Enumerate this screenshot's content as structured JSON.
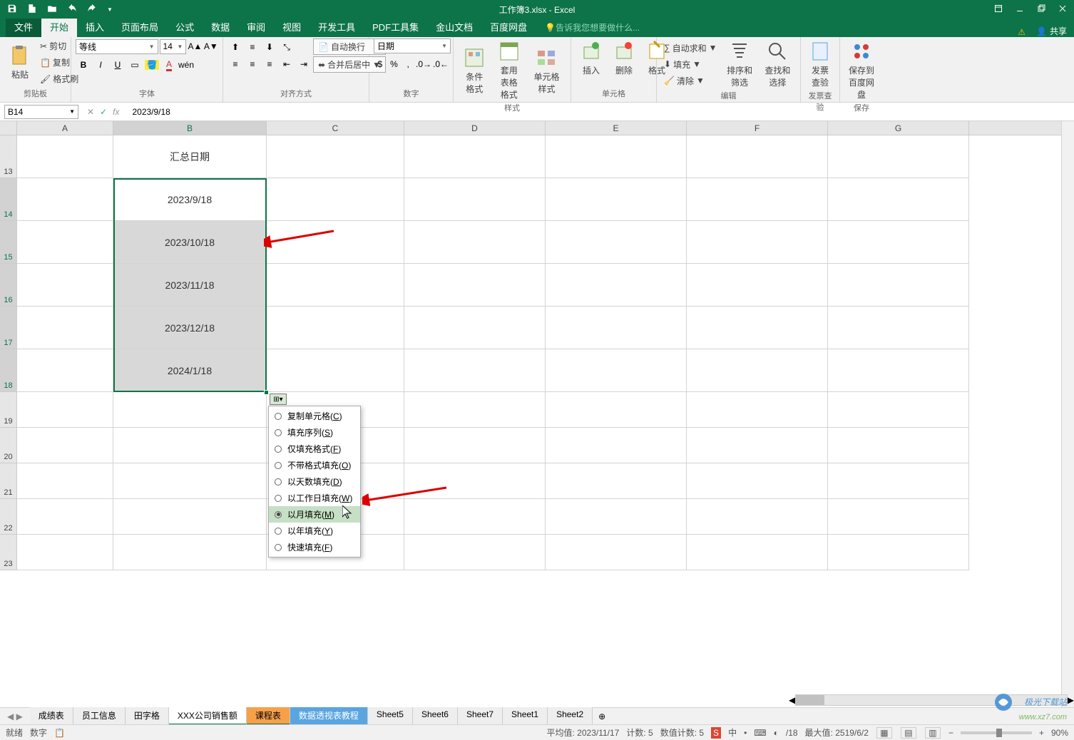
{
  "title": "工作簿3.xlsx - Excel",
  "tabs": {
    "file": "文件",
    "home": "开始",
    "insert": "插入",
    "layout": "页面布局",
    "formulas": "公式",
    "data": "数据",
    "review": "审阅",
    "view": "视图",
    "dev": "开发工具",
    "pdf": "PDF工具集",
    "wps": "金山文档",
    "baidu": "百度网盘"
  },
  "tellme": "告诉我您想要做什么...",
  "share": "共享",
  "ribbon": {
    "clipboard": {
      "paste": "粘贴",
      "cut": "剪切",
      "copy": "复制",
      "painter": "格式刷",
      "label": "剪贴板"
    },
    "font": {
      "name": "等线",
      "size": "14",
      "label": "字体"
    },
    "align": {
      "wrap": "自动换行",
      "merge": "合并后居中",
      "label": "对齐方式"
    },
    "number": {
      "format": "日期",
      "label": "数字"
    },
    "styles": {
      "cond": "条件格式",
      "table": "套用\n表格格式",
      "cell": "单元格样式",
      "label": "样式"
    },
    "cells": {
      "insert": "插入",
      "delete": "删除",
      "format": "格式",
      "label": "单元格"
    },
    "editing": {
      "sum": "自动求和",
      "fill": "填充",
      "clear": "清除",
      "sort": "排序和筛选",
      "find": "查找和选择",
      "label": "编辑"
    },
    "invoice": {
      "btn": "发票\n查验",
      "label": "发票查验"
    },
    "baidusave": {
      "btn": "保存到\n百度网盘",
      "label": "保存"
    }
  },
  "namebox": "B14",
  "formula": "2023/9/18",
  "columns": [
    "A",
    "B",
    "C",
    "D",
    "E",
    "F",
    "G"
  ],
  "rows_visible": [
    "13",
    "14",
    "15",
    "16",
    "17",
    "18",
    "19",
    "20",
    "21",
    "22",
    "23"
  ],
  "cells": {
    "B13": "汇总日期",
    "B14": "2023/9/18",
    "B15": "2023/10/18",
    "B16": "2023/11/18",
    "B17": "2023/12/18",
    "B18": "2024/1/18"
  },
  "autofill_menu": [
    {
      "label": "复制单元格",
      "key": "C"
    },
    {
      "label": "填充序列",
      "key": "S"
    },
    {
      "label": "仅填充格式",
      "key": "F"
    },
    {
      "label": "不带格式填充",
      "key": "O"
    },
    {
      "label": "以天数填充",
      "key": "D"
    },
    {
      "label": "以工作日填充",
      "key": "W"
    },
    {
      "label": "以月填充",
      "key": "M"
    },
    {
      "label": "以年填充",
      "key": "Y"
    },
    {
      "label": "快速填充",
      "key": "F"
    }
  ],
  "autofill_selected": 6,
  "sheets": [
    "成绩表",
    "员工信息",
    "田字格",
    "XXX公司销售额",
    "课程表",
    "数据透视表教程",
    "Sheet5",
    "Sheet6",
    "Sheet7",
    "Sheet1",
    "Sheet2"
  ],
  "active_sheet": 4,
  "status": {
    "ready": "就绪",
    "calc": "数字",
    "avg": "平均值: 2023/11/17",
    "count": "计数: 5",
    "ncount": "数值计数: 5",
    "min": "/18",
    "max": "最大值: 2519/6/2",
    "zoom": "90%"
  },
  "watermark": "极光下载站",
  "watermark_url": "www.xz7.com"
}
